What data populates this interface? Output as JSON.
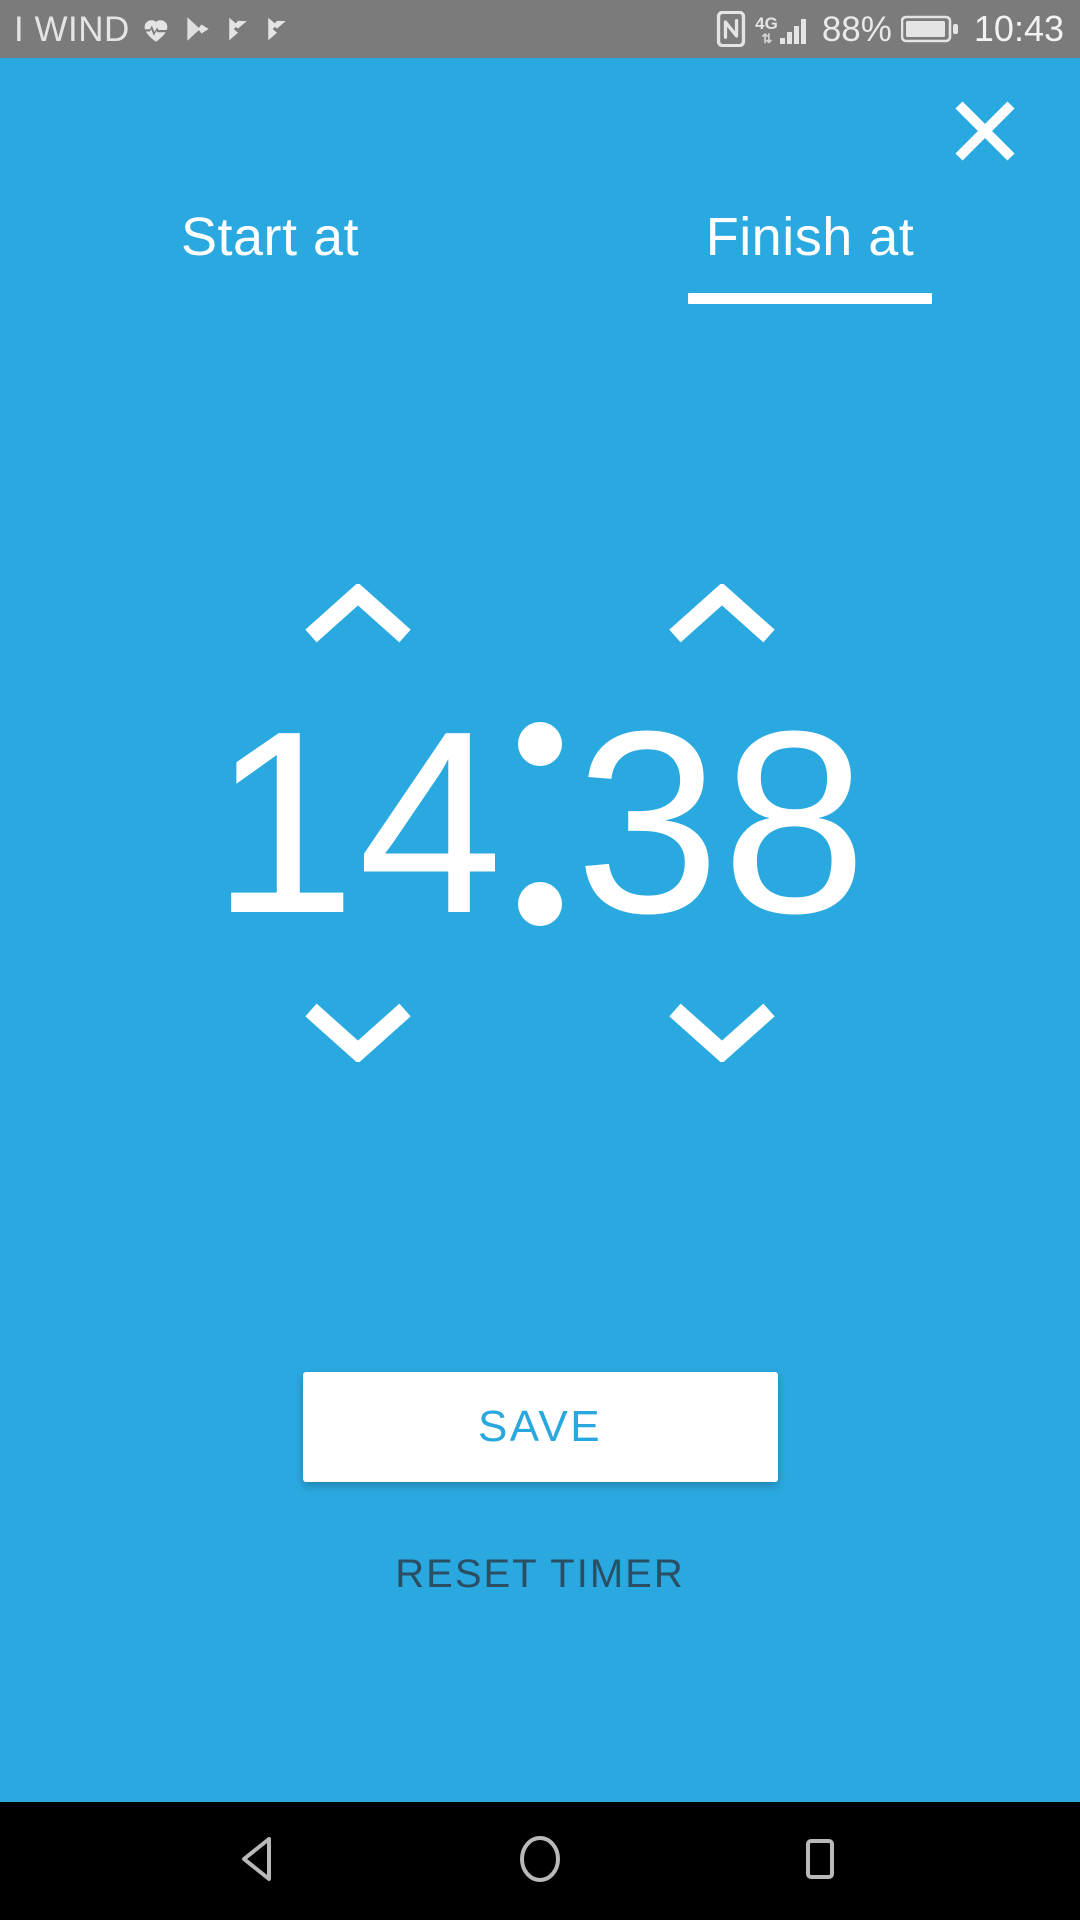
{
  "status_bar": {
    "carrier": "I WIND",
    "left_icons": [
      "heartbeat-icon",
      "play-store-icon",
      "play-store-update-icon",
      "play-store-update-icon"
    ],
    "nfc_icon": "nfc-icon",
    "network_type": "4G",
    "data_arrows": "⇅",
    "signal_icon": "signal-bars-icon",
    "battery_percent": "88%",
    "battery_icon": "battery-icon",
    "clock": "10:43",
    "background_color": "#7b7b7b",
    "text_color": "#e9e9e9"
  },
  "header": {
    "close_icon": "close-icon"
  },
  "tabs": [
    {
      "label": "Start at",
      "active": false
    },
    {
      "label": "Finish at",
      "active": true
    }
  ],
  "time_picker": {
    "hours": {
      "value": "14",
      "increment_icon": "chevron-up-icon",
      "decrement_icon": "chevron-down-icon"
    },
    "separator": ":",
    "minutes": {
      "value": "38",
      "increment_icon": "chevron-up-icon",
      "decrement_icon": "chevron-down-icon"
    }
  },
  "actions": {
    "save_label": "SAVE",
    "reset_label": "RESET TIMER"
  },
  "nav_bar": {
    "back_icon": "back-triangle-icon",
    "home_icon": "home-circle-icon",
    "recents_icon": "recents-square-icon",
    "background_color": "#000000"
  },
  "colors": {
    "accent": "#2aa9e0",
    "save_text": "#29a8df",
    "reset_text": "#2a4e63",
    "white": "#ffffff"
  }
}
